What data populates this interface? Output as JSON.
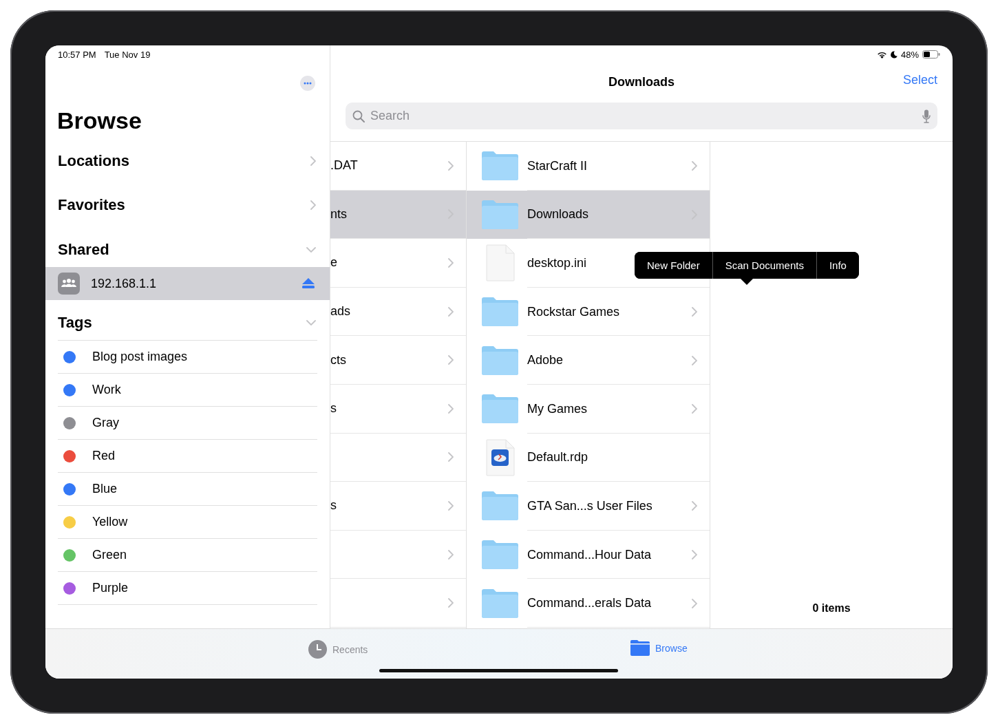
{
  "status_bar": {
    "time": "10:57 PM",
    "date": "Tue Nov 19",
    "battery": "48%"
  },
  "sidebar": {
    "title": "Browse",
    "sections": [
      {
        "label": "Locations",
        "expanded": false
      },
      {
        "label": "Favorites",
        "expanded": false
      },
      {
        "label": "Shared",
        "expanded": true,
        "items": [
          {
            "kind": "server",
            "label": "192.168.1.1",
            "selected": true
          }
        ]
      },
      {
        "label": "Tags",
        "expanded": true,
        "items": [
          {
            "kind": "tag",
            "label": "Blog post images",
            "color": "#3478f6",
            "selected": false
          },
          {
            "kind": "tag",
            "label": "Work",
            "color": "#3478f6",
            "selected": false
          },
          {
            "kind": "tag",
            "label": "Gray",
            "color": "#8e8e93",
            "selected": false
          },
          {
            "kind": "tag",
            "label": "Red",
            "color": "#eb4d3d",
            "selected": false
          },
          {
            "kind": "tag",
            "label": "Blue",
            "color": "#3478f6",
            "selected": false
          },
          {
            "kind": "tag",
            "label": "Yellow",
            "color": "#f7cd46",
            "selected": false
          },
          {
            "kind": "tag",
            "label": "Green",
            "color": "#65c466",
            "selected": false
          },
          {
            "kind": "tag",
            "label": "Purple",
            "color": "#a65ce0",
            "selected": false
          }
        ]
      }
    ]
  },
  "header": {
    "title": "Downloads",
    "action": "Select",
    "search_placeholder": "Search"
  },
  "columns": [
    {
      "rows": [
        {
          "label": ".DAT",
          "selected": false
        },
        {
          "label": "nts",
          "selected": true
        },
        {
          "label": "e",
          "selected": false
        },
        {
          "label": "ads",
          "selected": false
        },
        {
          "label": "cts",
          "selected": false
        },
        {
          "label": "s",
          "selected": false
        },
        {
          "selected": false
        },
        {
          "label": "s",
          "selected": false
        },
        {
          "selected": false
        },
        {
          "selected": false
        }
      ]
    },
    {
      "rows": [
        {
          "label": "StarCraft II",
          "kind": "folder",
          "selected": false
        },
        {
          "label": "Downloads",
          "kind": "folder",
          "selected": true
        },
        {
          "label": "desktop.ini",
          "kind": "file",
          "selected": false
        },
        {
          "label": "Rockstar Games",
          "kind": "folder",
          "selected": false
        },
        {
          "label": "Adobe",
          "kind": "folder",
          "selected": false
        },
        {
          "label": "My Games",
          "kind": "folder",
          "selected": false
        },
        {
          "label": "Default.rdp",
          "kind": "rdp",
          "selected": false
        },
        {
          "label": "GTA San...s User Files",
          "kind": "folder",
          "selected": false
        },
        {
          "label": "Command...Hour Data",
          "kind": "folder",
          "selected": false
        },
        {
          "label": "Command...erals Data",
          "kind": "folder",
          "selected": false
        }
      ]
    },
    {
      "footer": "0 items"
    }
  ],
  "context_menu": {
    "items": [
      "New Folder",
      "Scan Documents",
      "Info"
    ]
  },
  "tab_bar": [
    {
      "label": "Recents",
      "kind": "clock",
      "selected": false
    },
    {
      "label": "Browse",
      "kind": "folder",
      "selected": true
    }
  ]
}
